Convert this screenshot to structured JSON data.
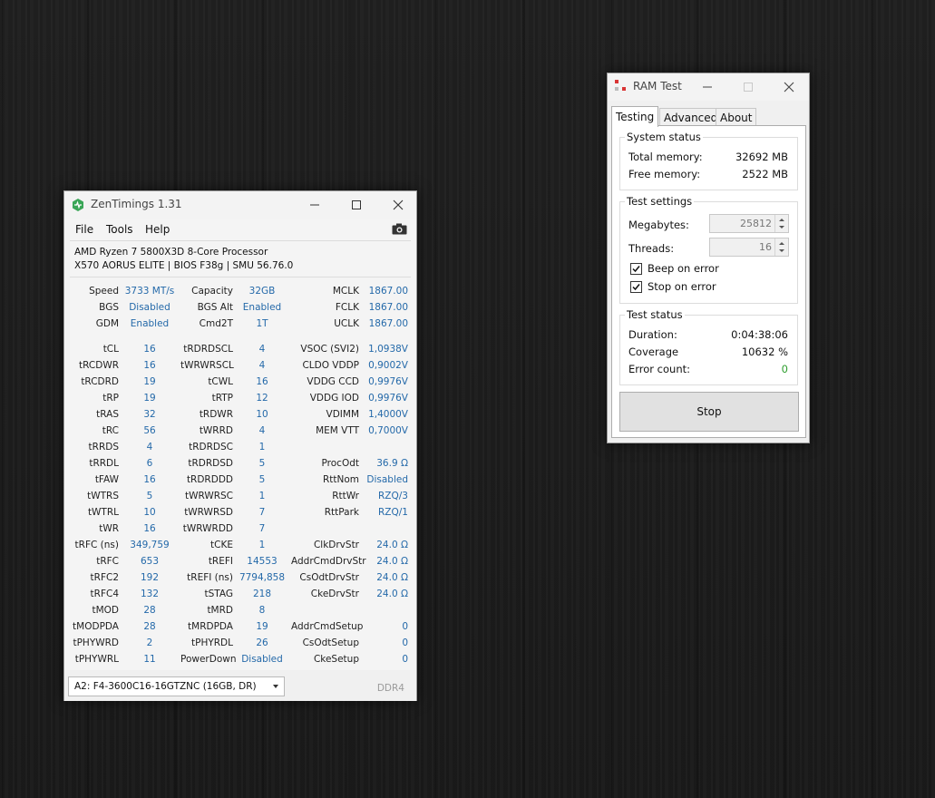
{
  "colors": {
    "value_blue": "#2469a9",
    "error_ok_green": "#2e9e2e",
    "accent_green": "#3aa657"
  },
  "zentimings": {
    "title": "ZenTimings 1.31",
    "menu": [
      "File",
      "Tools",
      "Help"
    ],
    "cpu_name": "AMD Ryzen 7 5800X3D 8-Core Processor",
    "board_info": "X570 AORUS ELITE | BIOS F38g | SMU 56.76.0",
    "summary": [
      [
        "Speed",
        "3733 MT/s",
        "Capacity",
        "32GB",
        "MCLK",
        "1867.00"
      ],
      [
        "BGS",
        "Disabled",
        "BGS Alt",
        "Enabled",
        "FCLK",
        "1867.00"
      ],
      [
        "GDM",
        "Enabled",
        "Cmd2T",
        "1T",
        "UCLK",
        "1867.00"
      ]
    ],
    "timings": [
      [
        "tCL",
        "16",
        "tRDRDSCL",
        "4",
        "VSOC (SVI2)",
        "1,0938V"
      ],
      [
        "tRCDWR",
        "16",
        "tWRWRSCL",
        "4",
        "CLDO VDDP",
        "0,9002V"
      ],
      [
        "tRCDRD",
        "19",
        "tCWL",
        "16",
        "VDDG CCD",
        "0,9976V"
      ],
      [
        "tRP",
        "19",
        "tRTP",
        "12",
        "VDDG IOD",
        "0,9976V"
      ],
      [
        "tRAS",
        "32",
        "tRDWR",
        "10",
        "VDIMM",
        "1,4000V"
      ],
      [
        "tRC",
        "56",
        "tWRRD",
        "4",
        "MEM VTT",
        "0,7000V"
      ],
      [
        "tRRDS",
        "4",
        "tRDRDSC",
        "1",
        "",
        ""
      ],
      [
        "tRRDL",
        "6",
        "tRDRDSD",
        "5",
        "ProcOdt",
        "36.9 Ω"
      ],
      [
        "tFAW",
        "16",
        "tRDRDDD",
        "5",
        "RttNom",
        "Disabled"
      ],
      [
        "tWTRS",
        "5",
        "tWRWRSC",
        "1",
        "RttWr",
        "RZQ/3"
      ],
      [
        "tWTRL",
        "10",
        "tWRWRSD",
        "7",
        "RttPark",
        "RZQ/1"
      ],
      [
        "tWR",
        "16",
        "tWRWRDD",
        "7",
        "",
        ""
      ],
      [
        "tRFC (ns)",
        "349,759",
        "tCKE",
        "1",
        "ClkDrvStr",
        "24.0 Ω"
      ],
      [
        "tRFC",
        "653",
        "tREFI",
        "14553",
        "AddrCmdDrvStr",
        "24.0 Ω"
      ],
      [
        "tRFC2",
        "192",
        "tREFI (ns)",
        "7794,858",
        "CsOdtDrvStr",
        "24.0 Ω"
      ],
      [
        "tRFC4",
        "132",
        "tSTAG",
        "218",
        "CkeDrvStr",
        "24.0 Ω"
      ],
      [
        "tMOD",
        "28",
        "tMRD",
        "8",
        "",
        ""
      ],
      [
        "tMODPDA",
        "28",
        "tMRDPDA",
        "19",
        "AddrCmdSetup",
        "0"
      ],
      [
        "tPHYWRD",
        "2",
        "tPHYRDL",
        "26",
        "CsOdtSetup",
        "0"
      ],
      [
        "tPHYWRL",
        "11",
        "PowerDown",
        "Disabled",
        "CkeSetup",
        "0"
      ]
    ],
    "dimm_selected": "A2: F4-3600C16-16GTZNC (16GB, DR)",
    "memory_type": "DDR4"
  },
  "ramtest": {
    "title": "RAM Test",
    "tabs": [
      "Testing",
      "Advanced",
      "About"
    ],
    "system_status": {
      "title": "System status",
      "total_label": "Total memory:",
      "total_value": "32692 MB",
      "free_label": "Free memory:",
      "free_value": "2522 MB"
    },
    "test_settings": {
      "title": "Test settings",
      "megabytes_label": "Megabytes:",
      "megabytes_value": "25812",
      "threads_label": "Threads:",
      "threads_value": "16",
      "beep_label": "Beep on error",
      "beep_checked": true,
      "stop_label": "Stop on error",
      "stop_checked": true
    },
    "test_status": {
      "title": "Test status",
      "duration_label": "Duration:",
      "duration_value": "0:04:38:06",
      "coverage_label": "Coverage",
      "coverage_value": "10632 %",
      "errors_label": "Error count:",
      "errors_value": "0"
    },
    "stop_label": "Stop"
  }
}
